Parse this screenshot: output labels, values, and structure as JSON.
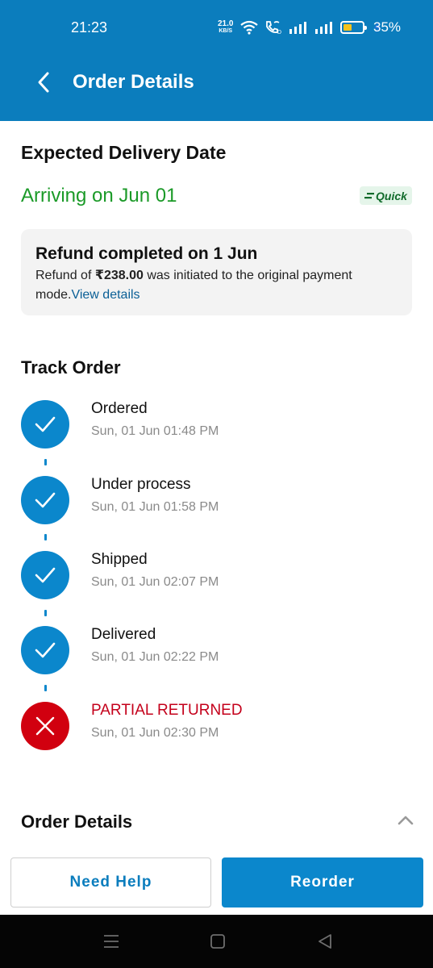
{
  "status_bar": {
    "time": "21:23",
    "speed_value": "21.0",
    "speed_unit": "KB/S",
    "battery_pct": "35%",
    "icons": [
      "wifi-icon",
      "wifi-calling-icon",
      "signal-icon",
      "signal-icon",
      "battery-icon",
      "charging-icon"
    ]
  },
  "header": {
    "title": "Order Details",
    "back_icon": "back-arrow-icon"
  },
  "delivery": {
    "section_title": "Expected Delivery Date",
    "arriving_text": "Arriving on Jun 01",
    "badge_label": "Quick"
  },
  "refund": {
    "title": "Refund completed on 1 Jun",
    "text_prefix": "Refund of ",
    "amount": "₹238.00",
    "text_suffix": " was initiated to the original payment mode.",
    "link_label": "View details"
  },
  "track": {
    "section_title": "Track Order",
    "steps": [
      {
        "label": "Ordered",
        "time": "Sun, 01 Jun 01:48 PM",
        "status": "done"
      },
      {
        "label": "Under process",
        "time": "Sun, 01 Jun 01:58 PM",
        "status": "done"
      },
      {
        "label": "Shipped",
        "time": "Sun, 01 Jun 02:07 PM",
        "status": "done"
      },
      {
        "label": "Delivered",
        "time": "Sun, 01 Jun 02:22 PM",
        "status": "done"
      },
      {
        "label": "PARTIAL RETURNED",
        "time": "Sun, 01 Jun 02:30 PM",
        "status": "returned"
      }
    ]
  },
  "order_details": {
    "section_title": "Order Details"
  },
  "actions": {
    "help_label": "Need Help",
    "reorder_label": "Reorder"
  },
  "colors": {
    "brand": "#0b7dbd",
    "step_done": "#0b87cc",
    "step_returned": "#d1000f",
    "arriving": "#1b9a28"
  }
}
